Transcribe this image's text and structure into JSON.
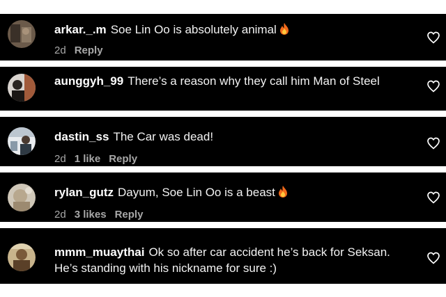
{
  "comments": [
    {
      "username": "arkar._.m",
      "text": "Soe Lin Oo is absolutely animal",
      "emoji": "fire",
      "time": "2d",
      "likes": "",
      "reply": "Reply"
    },
    {
      "username": "aunggyh_99",
      "text": "There’s a reason why they call him Man of Steel",
      "emoji": "",
      "time": "",
      "likes": "",
      "reply": ""
    },
    {
      "username": "dastin_ss",
      "text": "The Car was dead!",
      "emoji": "",
      "time": "2d",
      "likes": "1 like",
      "reply": "Reply"
    },
    {
      "username": "rylan_gutz",
      "text": "Dayum, Soe Lin Oo is a beast",
      "emoji": "fire",
      "time": "2d",
      "likes": "3 likes",
      "reply": "Reply"
    },
    {
      "username": "mmm_muaythai",
      "text": "Ok so after car accident he’s back for Seksan. He’s standing with his nickname for sure :)",
      "emoji": "",
      "time": "",
      "likes": "",
      "reply": ""
    }
  ],
  "icons": {
    "like": "heart-outline-icon",
    "emoji": "fire-emoji-icon"
  },
  "colors": {
    "background": "#000000",
    "separator": "#ffffff",
    "text": "#ffffff",
    "meta": "#a8a8a8"
  }
}
